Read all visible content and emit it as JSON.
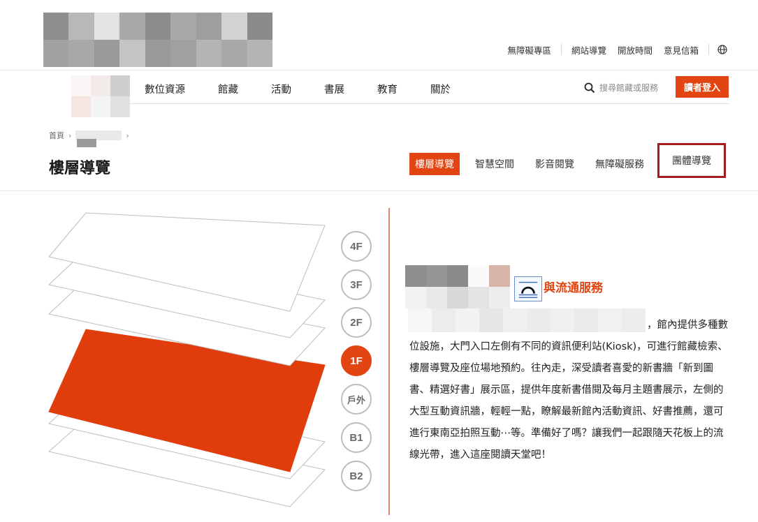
{
  "top_links": [
    "無障礙專區",
    "網站導覽",
    "開放時間",
    "意見信箱"
  ],
  "nav": {
    "items": [
      "數位資源",
      "館藏",
      "活動",
      "書展",
      "教育",
      "關於"
    ],
    "search_placeholder": "搜尋館藏或服務",
    "login_label": "讀者登入"
  },
  "breadcrumb": {
    "home": "首頁"
  },
  "page_title": "樓層導覽",
  "tabs": [
    {
      "label": "樓層導覽",
      "state": "active"
    },
    {
      "label": "智慧空間",
      "state": "normal"
    },
    {
      "label": "影音閱覽",
      "state": "normal"
    },
    {
      "label": "無障礙服務",
      "state": "normal"
    },
    {
      "label": "團體導覽",
      "state": "outlined"
    }
  ],
  "floors": [
    "4F",
    "3F",
    "2F",
    "1F",
    "戶外",
    "B1",
    "B2"
  ],
  "selected_floor": "1F",
  "section": {
    "title_visible": "與流通服務",
    "paragraph_tail_first_line": "，館內提供多種數",
    "paragraph": "位設施，大門入口左側有不同的資訊便利站(Kiosk)，可進行館藏檢索、樓層導覽及座位場地預約。往內走，深受讀者喜愛的新書牆「新到圖書、精選好書」展示區，提供年度新書借閱及每月主題書展示，左側的大型互動資訊牆，輕輕一點，瞭解最新館內活動資訊、好書推薦，還可進行東南亞拍照互動⋯等。準備好了嗎？讓我們一起跟隨天花板上的流線光帶，進入這座閱讀天堂吧！"
  },
  "colors": {
    "accent": "#e24512",
    "outline": "#a31f1f"
  }
}
